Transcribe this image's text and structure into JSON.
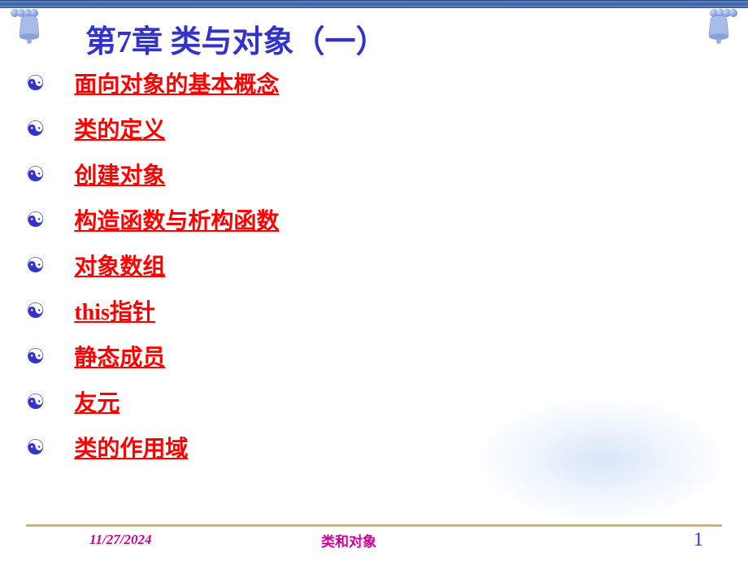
{
  "title": {
    "prefix": "第",
    "number": "7",
    "suffix": "章 类与对象（一）"
  },
  "items": [
    "面向对象的基本概念",
    "类的定义",
    "创建对象",
    "构造函数与析构函数",
    "对象数组",
    "this指针",
    "静态成员",
    "友元",
    "类的作用域"
  ],
  "footer": {
    "date": "11/27/2024",
    "title": "类和对象",
    "page": "1"
  },
  "bullet_char": "☯"
}
